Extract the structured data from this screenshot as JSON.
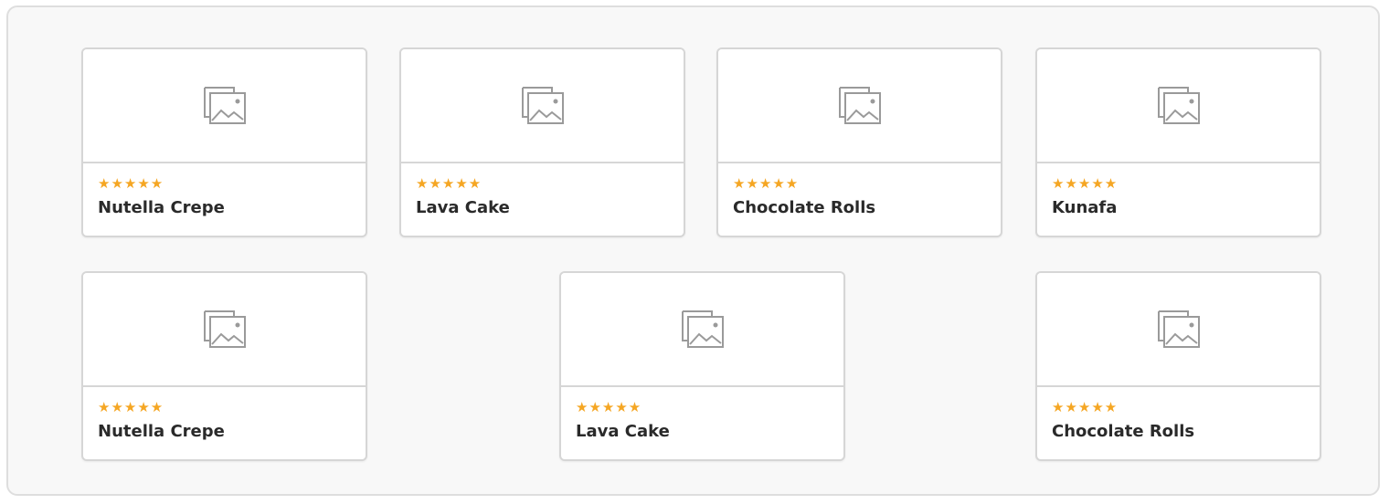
{
  "cards": [
    {
      "title": "Nutella Crepe",
      "rating": 5,
      "stars": "★★★★★",
      "image_icon": "image-placeholder-icon"
    },
    {
      "title": "Lava Cake",
      "rating": 5,
      "stars": "★★★★★",
      "image_icon": "image-placeholder-icon"
    },
    {
      "title": "Chocolate Rolls",
      "rating": 5,
      "stars": "★★★★★",
      "image_icon": "image-placeholder-icon"
    },
    {
      "title": "Kunafa",
      "rating": 5,
      "stars": "★★★★★",
      "image_icon": "image-placeholder-icon"
    },
    {
      "title": "Nutella Crepe",
      "rating": 5,
      "stars": "★★★★★",
      "image_icon": "image-placeholder-icon"
    },
    {
      "title": "Lava Cake",
      "rating": 5,
      "stars": "★★★★★",
      "image_icon": "image-placeholder-icon"
    },
    {
      "title": "Chocolate Rolls",
      "rating": 5,
      "stars": "★★★★★",
      "image_icon": "image-placeholder-icon"
    }
  ],
  "colors": {
    "star": "#f5a623",
    "title": "#2a2a2a",
    "card_border": "#d6d6d6",
    "panel_background": "#f8f8f8"
  }
}
